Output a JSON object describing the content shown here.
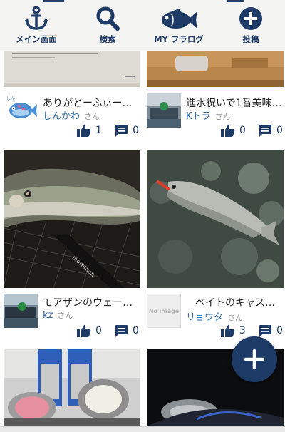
{
  "nav": {
    "items": [
      {
        "label": "メイン画面",
        "icon": "anchor-icon"
      },
      {
        "label": "検索",
        "icon": "search-icon"
      },
      {
        "label": "MY フラログ",
        "icon": "fish-icon"
      },
      {
        "label": "投稿",
        "icon": "plus-circle-icon"
      }
    ]
  },
  "posts": [
    {
      "title": "ありがとーふぃー…",
      "author": "しんかわ",
      "suffix": "さん",
      "likes": "1",
      "comments": "0",
      "avatar": "blue-fish-avatar"
    },
    {
      "title": "進水祝いで1番美味…",
      "author": "Kトラ",
      "suffix": "さん",
      "likes": "0",
      "comments": "0",
      "avatar": "boat-photo-avatar"
    },
    {
      "title": "モアザンのウェー…",
      "author": "kz",
      "suffix": "さん",
      "likes": "0",
      "comments": "0",
      "avatar": "boat-photo-avatar"
    },
    {
      "title": "ベイトのキャス…",
      "author": "リョウタ",
      "suffix": "さん",
      "likes": "3",
      "comments": "0",
      "avatar": "no-image-avatar",
      "avatar_text": "No image"
    }
  ],
  "colors": {
    "primary": "#1e3a66",
    "author": "#2f6aa8"
  },
  "fab": {
    "icon": "plus-icon"
  }
}
